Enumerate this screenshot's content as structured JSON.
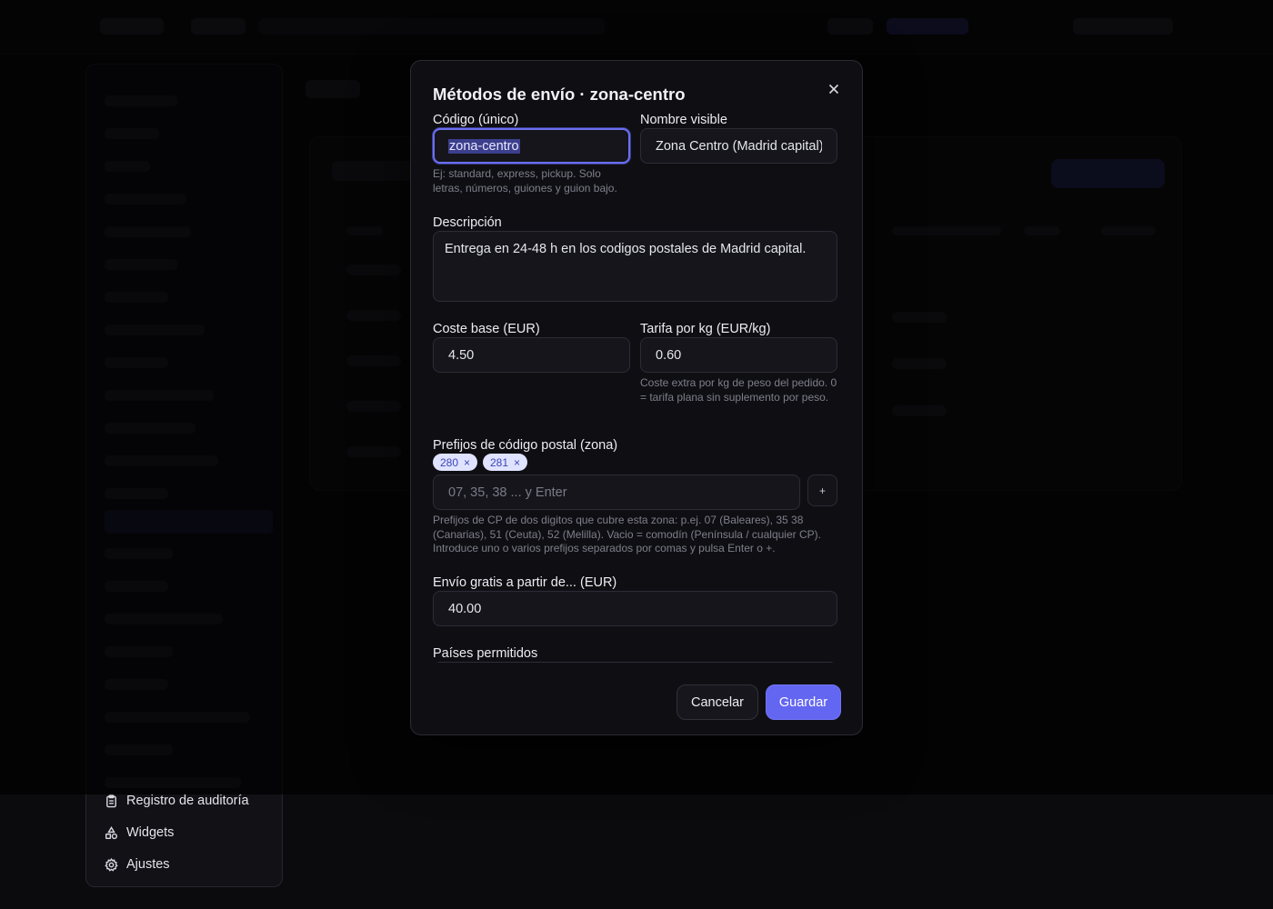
{
  "sidebar": {
    "items": [
      {
        "label": "Registro de auditoría",
        "icon": "clipboard-icon"
      },
      {
        "label": "Widgets",
        "icon": "shapes-icon"
      },
      {
        "label": "Ajustes",
        "icon": "gear-icon"
      }
    ]
  },
  "modal": {
    "title": "Métodos de envío · zona-centro",
    "code": {
      "label": "Código (único)",
      "value": "zona-centro",
      "help": "Ej: standard, express, pickup. Solo letras, números, guiones y guion bajo."
    },
    "name": {
      "label": "Nombre visible",
      "value": "Zona Centro (Madrid capital)"
    },
    "description": {
      "label": "Descripción",
      "value": "Entrega en 24-48 h en los codigos postales de Madrid capital."
    },
    "base_cost": {
      "label": "Coste base (EUR)",
      "value": "4.50"
    },
    "rate_per_kg": {
      "label": "Tarifa por kg (EUR/kg)",
      "value": "0.60",
      "help": "Coste extra por kg de peso del pedido. 0 = tarifa plana sin suplemento por peso."
    },
    "postal_prefixes": {
      "label": "Prefijos de código postal (zona)",
      "chips": [
        "280",
        "281"
      ],
      "placeholder": "07, 35, 38 ... y Enter",
      "add_label": "+",
      "help": "Prefijos de CP de dos digitos que cubre esta zona: p.ej. 07 (Baleares), 35 38 (Canarias), 51 (Ceuta), 52 (Melilla). Vacio = comodín (Península / cualquier CP). Introduce uno o varios prefijos separados por comas y pulsa Enter o +."
    },
    "free_shipping": {
      "label": "Envío gratis a partir de... (EUR)",
      "value": "40.00"
    },
    "countries": {
      "label": "Países permitidos"
    },
    "cancel_label": "Cancelar",
    "save_label": "Guardar"
  },
  "colors": {
    "accent": "#6366f1",
    "chip_bg": "#dfe3ff",
    "chip_text": "#3d44b8",
    "focus_ring": "#6b6ff0"
  }
}
